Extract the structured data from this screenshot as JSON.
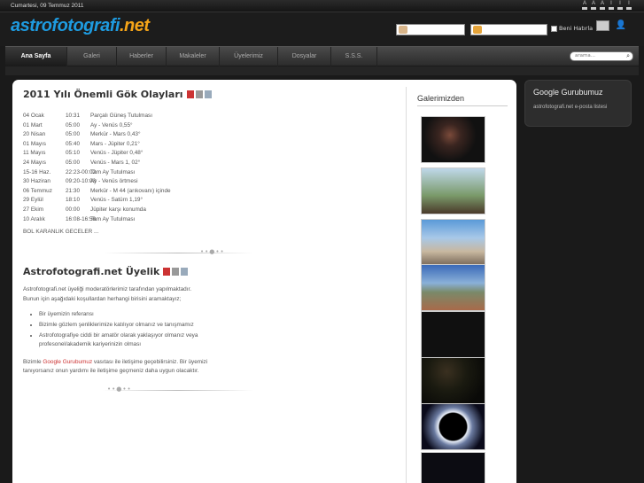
{
  "topbar": {
    "date": "Cumartesi, 09 Temmuz 2011"
  },
  "header": {
    "logo_part1": "astrofotografi",
    "logo_part2": ".net",
    "remember_label": "Beni Hatırla"
  },
  "nav": {
    "items": [
      "Ana Sayfa",
      "Galeri",
      "Haberler",
      "Makaleler",
      "Üyelerimiz",
      "Dosyalar",
      "S.S.S."
    ],
    "active": "Ana Sayfa",
    "search_placeholder": "arama..."
  },
  "article1": {
    "title": "2011 Yılı Önemli Gök Olayları",
    "events": [
      {
        "date": "04 Ocak",
        "time": "10:31",
        "event": "Parçalı Güneş Tutulması"
      },
      {
        "date": "01 Mart",
        "time": "05:00",
        "event": "Ay - Venüs  0,55°"
      },
      {
        "date": "20 Nisan",
        "time": "05:00",
        "event": "Merkür - Mars  0,43°"
      },
      {
        "date": "01 Mayıs",
        "time": "05:40",
        "event": "Mars - Jüpiter  0,21°"
      },
      {
        "date": "11 Mayıs",
        "time": "05:10",
        "event": "Venüs - Jüpiter  0,48°"
      },
      {
        "date": "24 Mayıs",
        "time": "05:00",
        "event": "Venüs - Mars  1, 02°"
      },
      {
        "date": "15-16 Haz.",
        "time": "22:23-00:02",
        "event": "Tam Ay Tutulması"
      },
      {
        "date": "30 Haziran",
        "time": "09:20-10:03",
        "event": "Ay - Venüs örtmesi"
      },
      {
        "date": "06 Temmuz",
        "time": "21:30",
        "event": "Merkür - M 44 (arıkovanı) içinde"
      },
      {
        "date": "29 Eylül",
        "time": "18:10",
        "event": "Venüs - Satürn  1,19°"
      },
      {
        "date": "27 Ekim",
        "time": "00:00",
        "event": "Jüpiter karşı konumda"
      },
      {
        "date": "10 Aralık",
        "time": "16:08-16:56",
        "event": "Tam Ay Tutulması"
      }
    ],
    "note": "BOL KARANLIK GECELER ..."
  },
  "article2": {
    "title": "Astrofotografi.net Üyelik",
    "intro": "Astrofotografi.net üyeliği moderatörlerimiz tarafından yapılmaktadır. Bunun için aşağıdaki koşullardan herhangi birisini aramaktayız;",
    "bullets": [
      "Bir üyemizin referansı",
      "Bizimle gözlem şenliklerimize katılıyor olmanız ve tanışmamız",
      "Astrofotografiye ciddi bir amatör olarak yaklaşıyor olmanız veya profesonel/akademik kariyerinizin olması"
    ],
    "outro_pre": "Bizimle ",
    "outro_link": "Google Gurubumuz",
    "outro_post": " vasıtası ile iletişime geçebilirsiniz. Bir üyemizi tanıyorsanız onun yardımı ile iletişime geçmeniz daha uygun olacaktır."
  },
  "gallery": {
    "title": "Galerimizden"
  },
  "sidebox": {
    "title": "Google Gurubumuz",
    "link": "astrofotografi.net e-posta listesi"
  },
  "colors": {
    "logo_blue": "#1e9be0",
    "logo_orange": "#f5a418",
    "link_red": "#cc3333"
  }
}
